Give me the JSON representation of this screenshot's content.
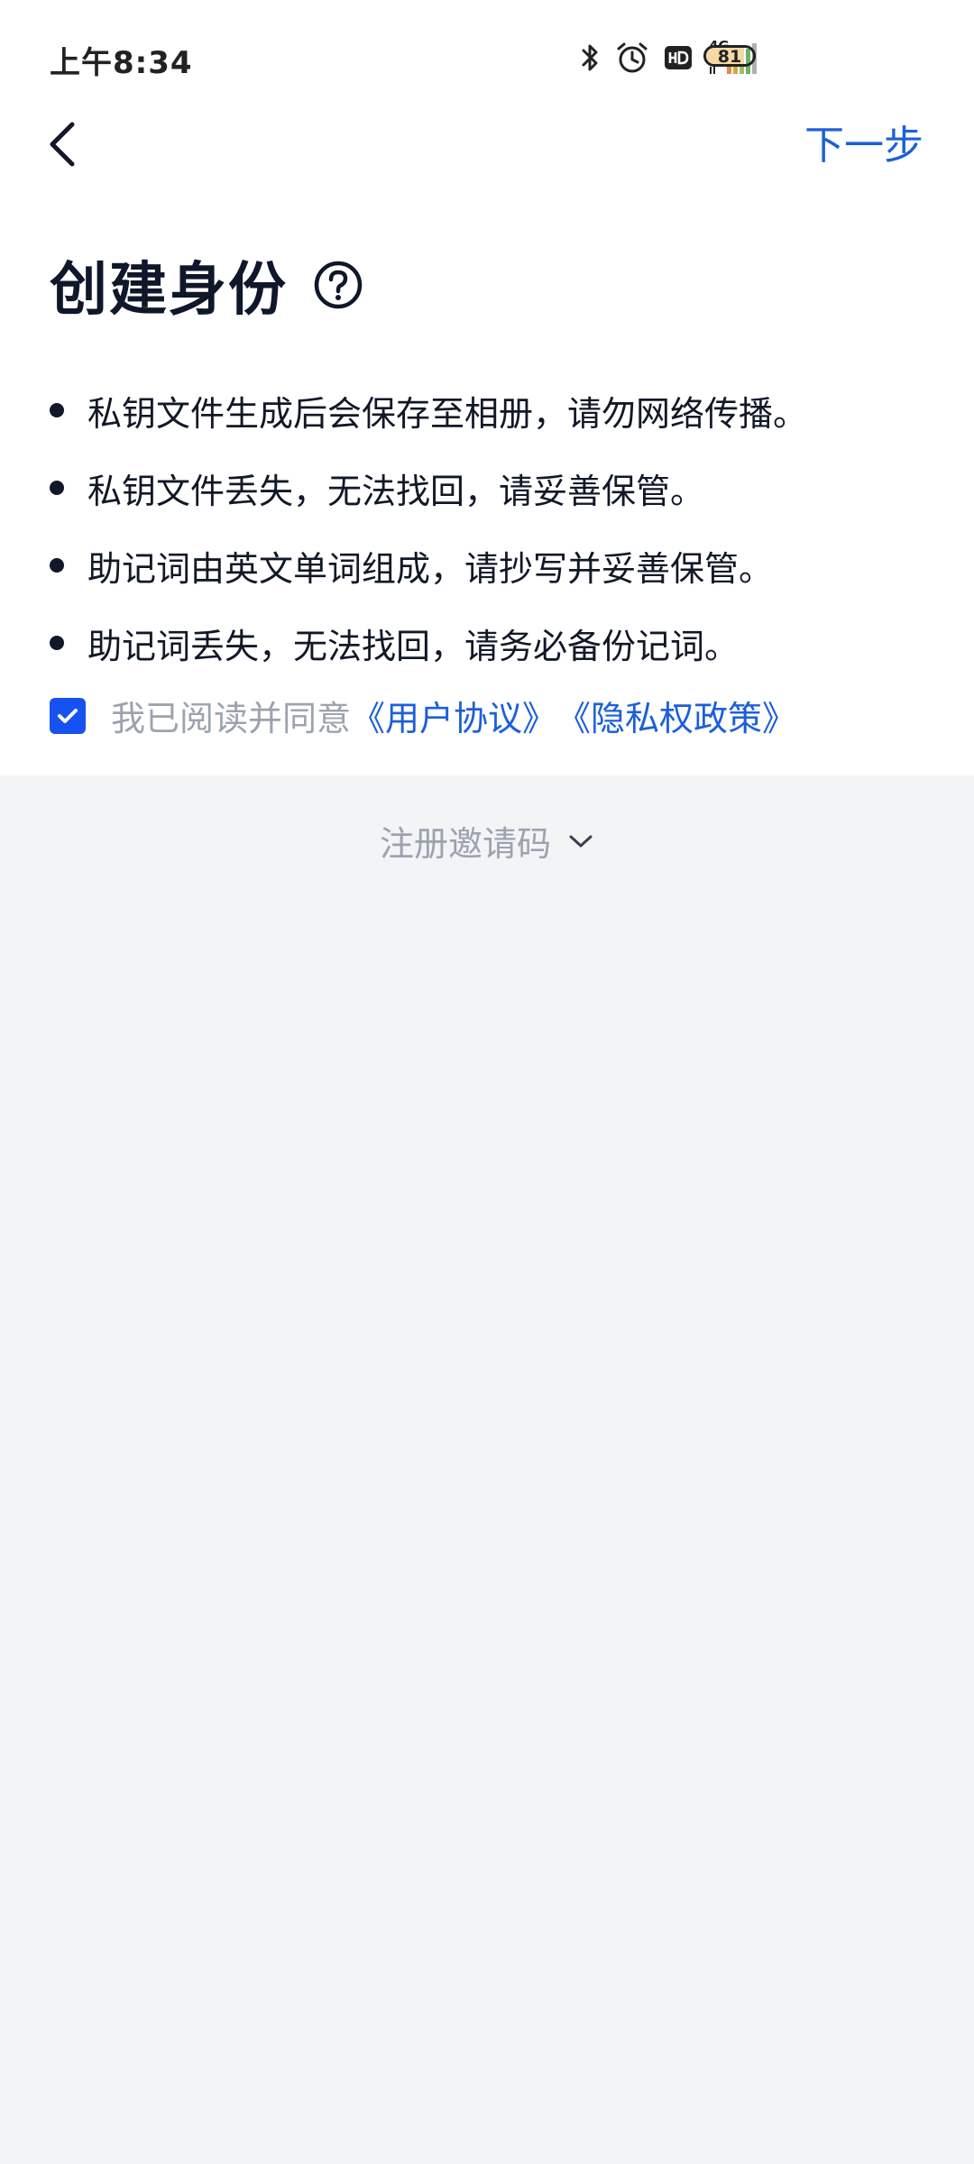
{
  "status_bar": {
    "time": "上午8:34",
    "network": "4G",
    "battery": "81",
    "battery_level": 0.81,
    "icons": [
      "bluetooth-icon",
      "alarm-icon",
      "hd-icon",
      "signal-icon",
      "battery-icon"
    ]
  },
  "nav": {
    "back_icon": "chevron-left-icon",
    "next_label": "下一步"
  },
  "title": "创建身份",
  "help_icon": "question-circle-icon",
  "bullets": [
    "私钥文件生成后会保存至相册，请勿网络传播。",
    "私钥文件丢失，无法找回，请妥善保管。",
    "助记词由英文单词组成，请抄写并妥善保管。",
    "助记词丢失，无法找回，请务必备份记词。"
  ],
  "agreement": {
    "checked": true,
    "prefix": "我已阅读并同意",
    "user_agreement": "《用户协议》",
    "privacy_policy": "《隐私权政策》"
  },
  "invite": {
    "label": "注册邀请码",
    "icon": "chevron-down-icon"
  },
  "colors": {
    "accent": "#1c5fd9",
    "checkbox": "#1652f0",
    "background": "#f3f4f6"
  }
}
